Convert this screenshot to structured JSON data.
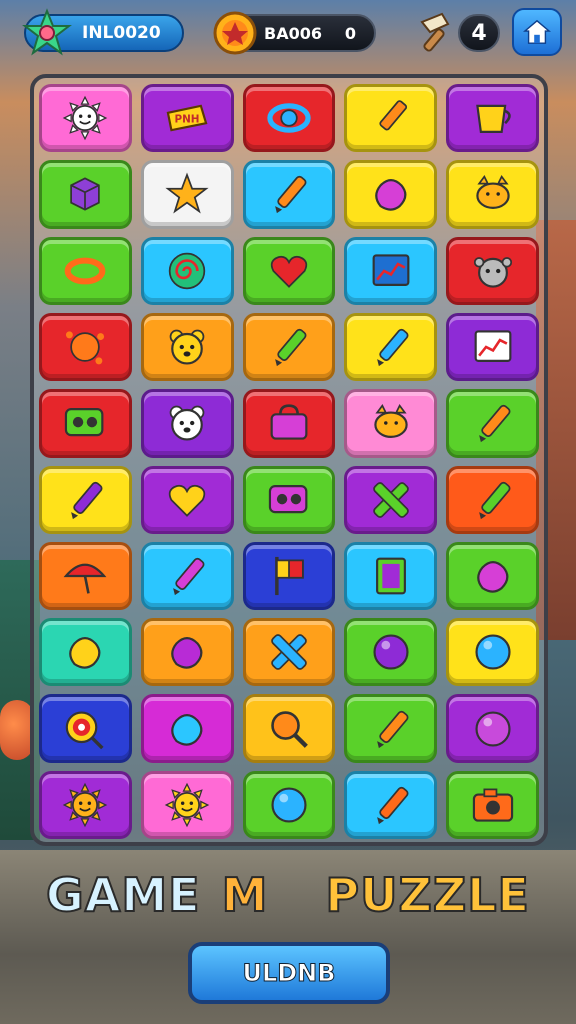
{
  "header": {
    "score_label": "INL0020",
    "coins_label": "BA006",
    "coins_value": "0",
    "round_label": "4"
  },
  "title": {
    "part1": "GAME",
    "part2": "M",
    "part3": "PUZZLE"
  },
  "play_button_label": "ULDNB",
  "icons": {
    "score": "star-icon",
    "coins": "coin-icon",
    "tool": "hammer-icon",
    "home": "home-icon"
  },
  "board": {
    "columns": 5,
    "rows": 10,
    "tiles": [
      {
        "name": "sun-face",
        "bg": "#ff6ad5",
        "fg": "#ffffff"
      },
      {
        "name": "sign",
        "bg": "#a12bd6",
        "fg": "#ffd21a"
      },
      {
        "name": "eye",
        "bg": "#e6262b",
        "fg": "#2bb3ff"
      },
      {
        "name": "crayon",
        "bg": "#ffe21a",
        "fg": "#ff8a1a"
      },
      {
        "name": "cup",
        "bg": "#a12bd6",
        "fg": "#ffd21a"
      },
      {
        "name": "cube",
        "bg": "#5ad12a",
        "fg": "#8e3fd6"
      },
      {
        "name": "star",
        "bg": "#f4f4f4",
        "fg": "#ffb21a"
      },
      {
        "name": "pencil",
        "bg": "#2bc6ff",
        "fg": "#ff8a1a"
      },
      {
        "name": "blob",
        "bg": "#ffe21a",
        "fg": "#d63fd6"
      },
      {
        "name": "cat",
        "bg": "#ffe21a",
        "fg": "#ffb21a"
      },
      {
        "name": "ring",
        "bg": "#5ad12a",
        "fg": "#ff6a1a"
      },
      {
        "name": "spiral",
        "bg": "#2bc6ff",
        "fg": "#22c07a"
      },
      {
        "name": "heart",
        "bg": "#5ad12a",
        "fg": "#e6262b"
      },
      {
        "name": "chart",
        "bg": "#2bc6ff",
        "fg": "#1e6fd1"
      },
      {
        "name": "monster",
        "bg": "#e6262b",
        "fg": "#bbbbbb"
      },
      {
        "name": "splash",
        "bg": "#e6262b",
        "fg": "#ff7a1a"
      },
      {
        "name": "bear",
        "bg": "#ffa01a",
        "fg": "#ffd21a"
      },
      {
        "name": "pencil",
        "bg": "#ffa01a",
        "fg": "#5ad12a"
      },
      {
        "name": "pencil",
        "bg": "#ffe21a",
        "fg": "#2bb3ff"
      },
      {
        "name": "chart",
        "bg": "#8e2bd6",
        "fg": "#ffffff"
      },
      {
        "name": "speaker",
        "bg": "#e6262b",
        "fg": "#5ad12a"
      },
      {
        "name": "bear",
        "bg": "#8e2bd6",
        "fg": "#ffffff"
      },
      {
        "name": "bag",
        "bg": "#e6262b",
        "fg": "#d63fd6"
      },
      {
        "name": "cat",
        "bg": "#ff8ad5",
        "fg": "#ffb21a"
      },
      {
        "name": "pencil",
        "bg": "#5ad12a",
        "fg": "#ff8a1a"
      },
      {
        "name": "pencil",
        "bg": "#ffe21a",
        "fg": "#8e2bd6"
      },
      {
        "name": "heart",
        "bg": "#a12bd6",
        "fg": "#ffd21a"
      },
      {
        "name": "speaker",
        "bg": "#5ad12a",
        "fg": "#d63fd6"
      },
      {
        "name": "cross",
        "bg": "#a12bd6",
        "fg": "#5ad12a"
      },
      {
        "name": "pencil",
        "bg": "#ff5a1a",
        "fg": "#5ad12a"
      },
      {
        "name": "umbrella",
        "bg": "#ff7a1a",
        "fg": "#e6262b"
      },
      {
        "name": "pencil",
        "bg": "#2bc6ff",
        "fg": "#d63fd6"
      },
      {
        "name": "flag",
        "bg": "#2b3fd6",
        "fg": "#ffd21a"
      },
      {
        "name": "card",
        "bg": "#2bc6ff",
        "fg": "#5ad12a"
      },
      {
        "name": "blob",
        "bg": "#5ad12a",
        "fg": "#d63fd6"
      },
      {
        "name": "blob",
        "bg": "#2bd6b2",
        "fg": "#ffd21a"
      },
      {
        "name": "blob",
        "bg": "#ffa01a",
        "fg": "#b82bd6"
      },
      {
        "name": "cross",
        "bg": "#ffa01a",
        "fg": "#2bb3ff"
      },
      {
        "name": "ball",
        "bg": "#5ad12a",
        "fg": "#8e2bd6"
      },
      {
        "name": "ball",
        "bg": "#ffe21a",
        "fg": "#2bb3ff"
      },
      {
        "name": "target",
        "bg": "#2b3fd6",
        "fg": "#ffd21a"
      },
      {
        "name": "blob",
        "bg": "#d62bd6",
        "fg": "#2bc6ff"
      },
      {
        "name": "search",
        "bg": "#ffc21a",
        "fg": "#ff8a1a"
      },
      {
        "name": "pencil",
        "bg": "#5ad12a",
        "fg": "#ff8a1a"
      },
      {
        "name": "ball",
        "bg": "#a12bd6",
        "fg": "#c84adb"
      },
      {
        "name": "sun-face",
        "bg": "#a12bd6",
        "fg": "#ffb21a"
      },
      {
        "name": "sun-face",
        "bg": "#ff6ad5",
        "fg": "#ffd21a"
      },
      {
        "name": "ball",
        "bg": "#5ad12a",
        "fg": "#2bb3ff"
      },
      {
        "name": "pencil",
        "bg": "#2bc6ff",
        "fg": "#ff6a1a"
      },
      {
        "name": "camera",
        "bg": "#5ad12a",
        "fg": "#ff6a1a"
      }
    ]
  }
}
